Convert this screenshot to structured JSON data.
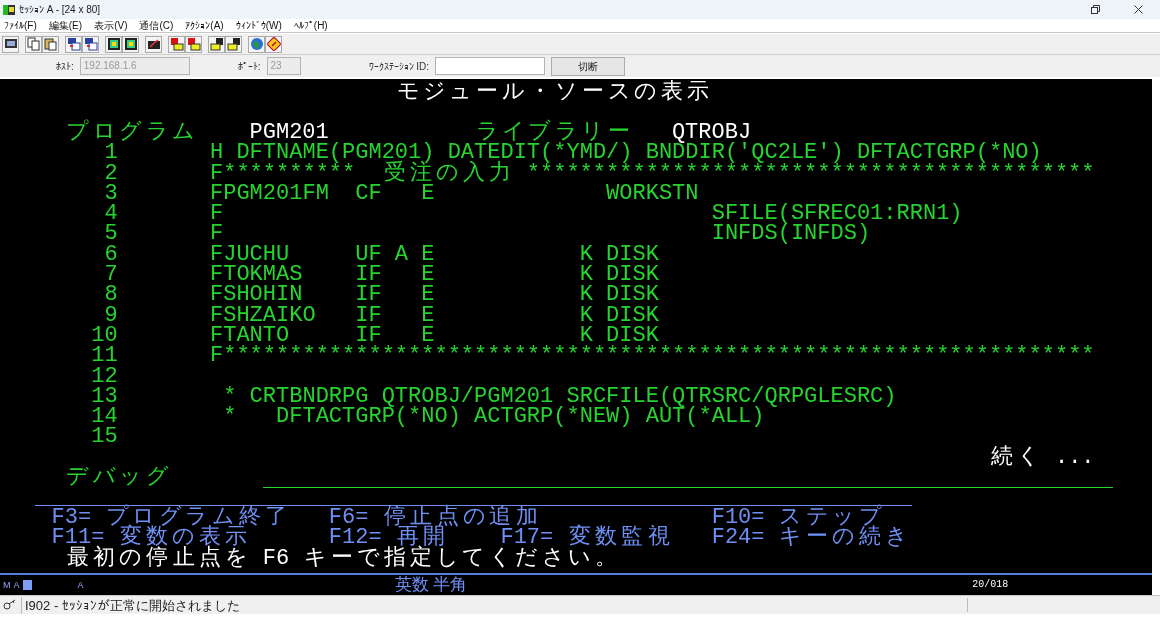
{
  "window": {
    "title": "ｾｯｼｮﾝ A - [24 x 80]"
  },
  "menu": [
    "ﾌｧｲﾙ(F)",
    "編集(E)",
    "表示(V)",
    "通信(C)",
    "ｱｸｼｮﾝ(A)",
    "ｳｨﾝﾄﾞｳ(W)",
    "ﾍﾙﾌﾟ(H)"
  ],
  "connection": {
    "host": {
      "label": "ﾎｽﾄ:",
      "value": "192.168.1.6",
      "disabled": true
    },
    "port": {
      "label": "ﾎﾟｰﾄ:",
      "value": "23",
      "disabled": true
    },
    "workstation_id": {
      "label": "ﾜｰｸｽﾃｰｼｮﾝ ID:",
      "disabled": false
    },
    "disconnect_button": "切断"
  },
  "terminal": {
    "title": "モジュール・ソースの表示",
    "program_label": "プログラム",
    "program": "PGM201",
    "library_label": "ライブラリー",
    "library": "QTROBJ",
    "lines": [
      {
        "number": "1",
        "code": "H DFTNAME(PGM201) DATEDIT(*YMD/) BNDDIR('QC2LE') DFTACTGRP(*NO)"
      },
      {
        "number": "2",
        "code": "F**********  受注の入力 *******************************************"
      },
      {
        "number": "3",
        "code": "FPGM201FM  CF   E             WORKSTN"
      },
      {
        "number": "4",
        "code": "F                                     SFILE(SFREC01:RRN1)"
      },
      {
        "number": "5",
        "code": "F                                     INFDS(INFDS)"
      },
      {
        "number": "6",
        "code": "FJUCHU     UF A E           K DISK"
      },
      {
        "number": "7",
        "code": "FTOKMAS    IF   E           K DISK"
      },
      {
        "number": "8",
        "code": "FSHOHIN    IF   E           K DISK"
      },
      {
        "number": "9",
        "code": "FSHZAIKO   IF   E           K DISK"
      },
      {
        "number": "10",
        "code": "FTANTO     IF   E           K DISK"
      },
      {
        "number": "11",
        "code": "F******************************************************************"
      },
      {
        "number": "12"
      },
      {
        "number": "13",
        "code": " * CRTBNDRPG QTROBJ/PGM201 SRCFILE(QTRSRC/QRPGLESRC)"
      },
      {
        "number": "14",
        "code": " *   DFTACTGRP(*NO) ACTGRP(*NEW) AUT(*ALL)"
      },
      {
        "number": "15"
      }
    ],
    "more": "続く ...",
    "debug_label": "デバッグ",
    "function_keys": [
      [
        "F3= プログラム終了",
        "F6= 停止点の追加",
        "F10= ステップ"
      ],
      [
        "F11= 変数の表示",
        "F12= 再開",
        "F17= 変数監視",
        "F24= キーの続き"
      ]
    ],
    "message": "最初の停止点を F6 キーで指定してください。"
  },
  "indicator": {
    "mode_1": "M",
    "mode_2": "A",
    "mode_3": "A",
    "input_mode": "英数 半角",
    "cursor_position": "20/018"
  },
  "status_bar": {
    "message": "I902 - ｾｯｼｮﾝが正常に開始されました"
  }
}
